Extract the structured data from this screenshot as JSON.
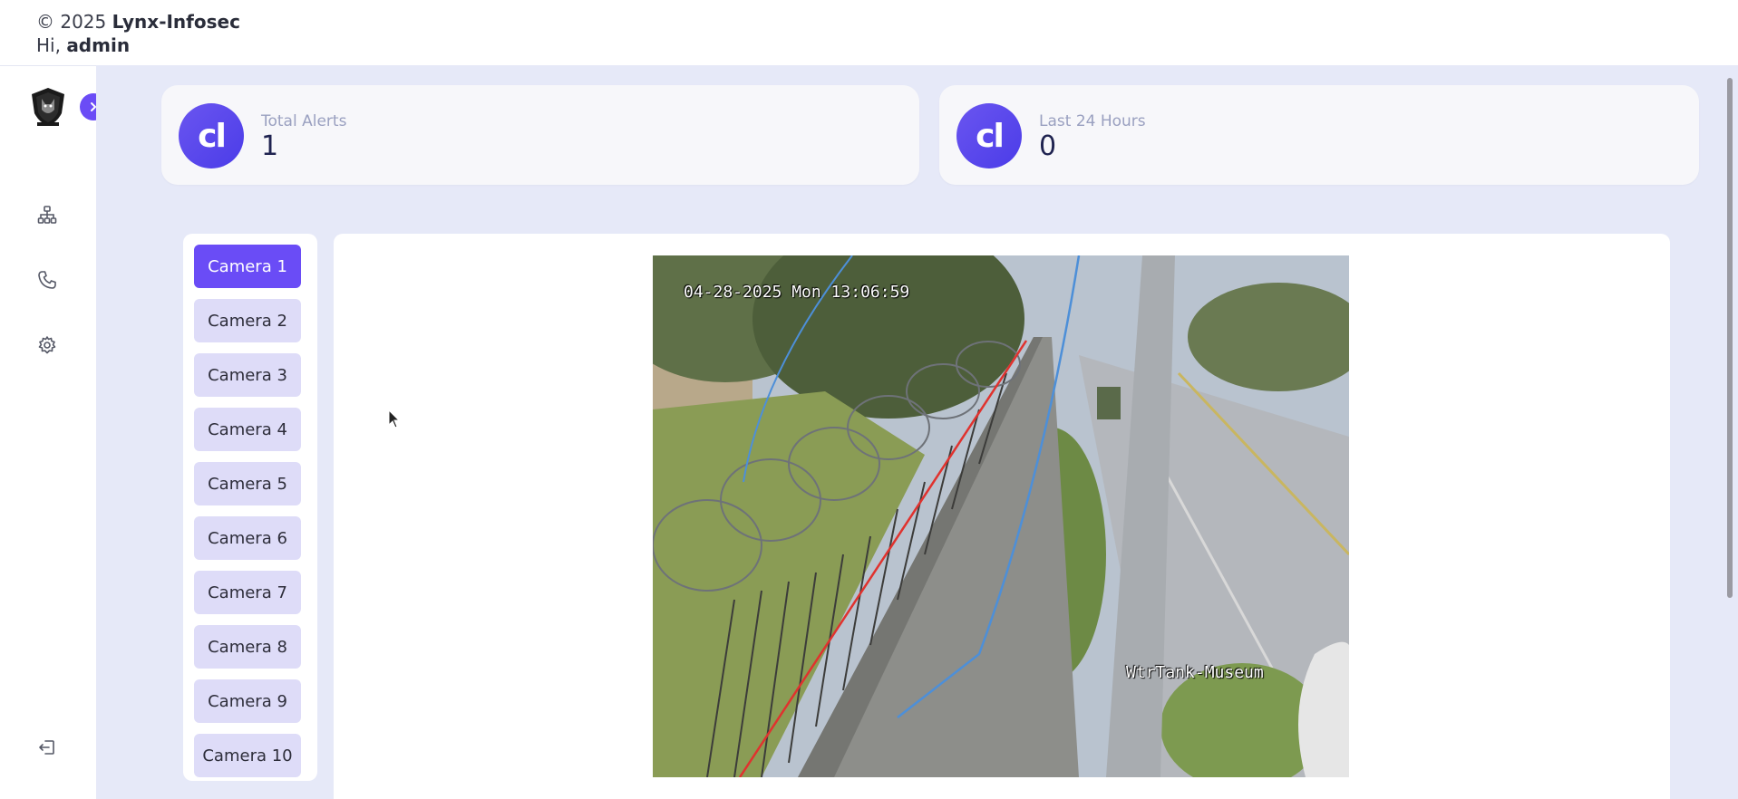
{
  "header": {
    "copyright_prefix": "© 2025",
    "company": "Lynx-Infosec",
    "greeting": "Hi,",
    "username": "admin"
  },
  "sidebar": {
    "logo_icon": "lynx-shield-logo-icon",
    "toggle_icon": "chevron-right-icon",
    "items": [
      {
        "icon": "network-hierarchy-icon"
      },
      {
        "icon": "phone-icon"
      },
      {
        "icon": "gear-icon"
      }
    ],
    "logout_icon": "logout-icon"
  },
  "stats": [
    {
      "label": "Total Alerts",
      "value": "1",
      "badge_text": "cl"
    },
    {
      "label": "Last 24 Hours",
      "value": "0",
      "badge_text": "cl"
    }
  ],
  "cameras": {
    "active_index": 0,
    "items": [
      "Camera 1",
      "Camera 2",
      "Camera 3",
      "Camera 4",
      "Camera 5",
      "Camera 6",
      "Camera 7",
      "Camera 8",
      "Camera 9",
      "Camera 10"
    ]
  },
  "feed": {
    "timestamp": "04-28-2025 Mon 13:06:59",
    "location": "WtrTank-Museum"
  },
  "colors": {
    "accent": "#6a4cf6",
    "camera_inactive_bg": "#dedcf8",
    "main_bg": "#e6e9f8",
    "stat_label": "#9aa0c0"
  }
}
